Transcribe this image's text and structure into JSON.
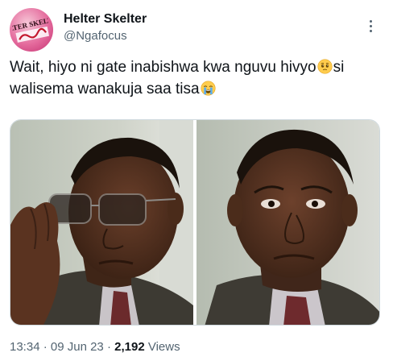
{
  "tweet": {
    "author": {
      "display_name": "Helter Skelter",
      "handle": "@Ngafocus",
      "avatar_text": "HELTER SKELTER"
    },
    "text_line1": "Wait, hiyo ni gate inabishwa kwa nguvu hivyo",
    "text_line1_end": "si",
    "text_line2": "walisema wanakuja saa tisa",
    "emojis": [
      "pleading-face-icon",
      "loudly-crying-face-icon"
    ],
    "media": {
      "panels": [
        "man-removing-glasses-image",
        "man-worried-expression-image"
      ]
    },
    "meta": {
      "time": "13:34",
      "separator": "·",
      "date": "09 Jun 23",
      "views_count": "2,192",
      "views_label": "Views"
    }
  },
  "colors": {
    "text": "#0f1419",
    "secondary": "#536471",
    "avatar": "#e46a9c"
  }
}
